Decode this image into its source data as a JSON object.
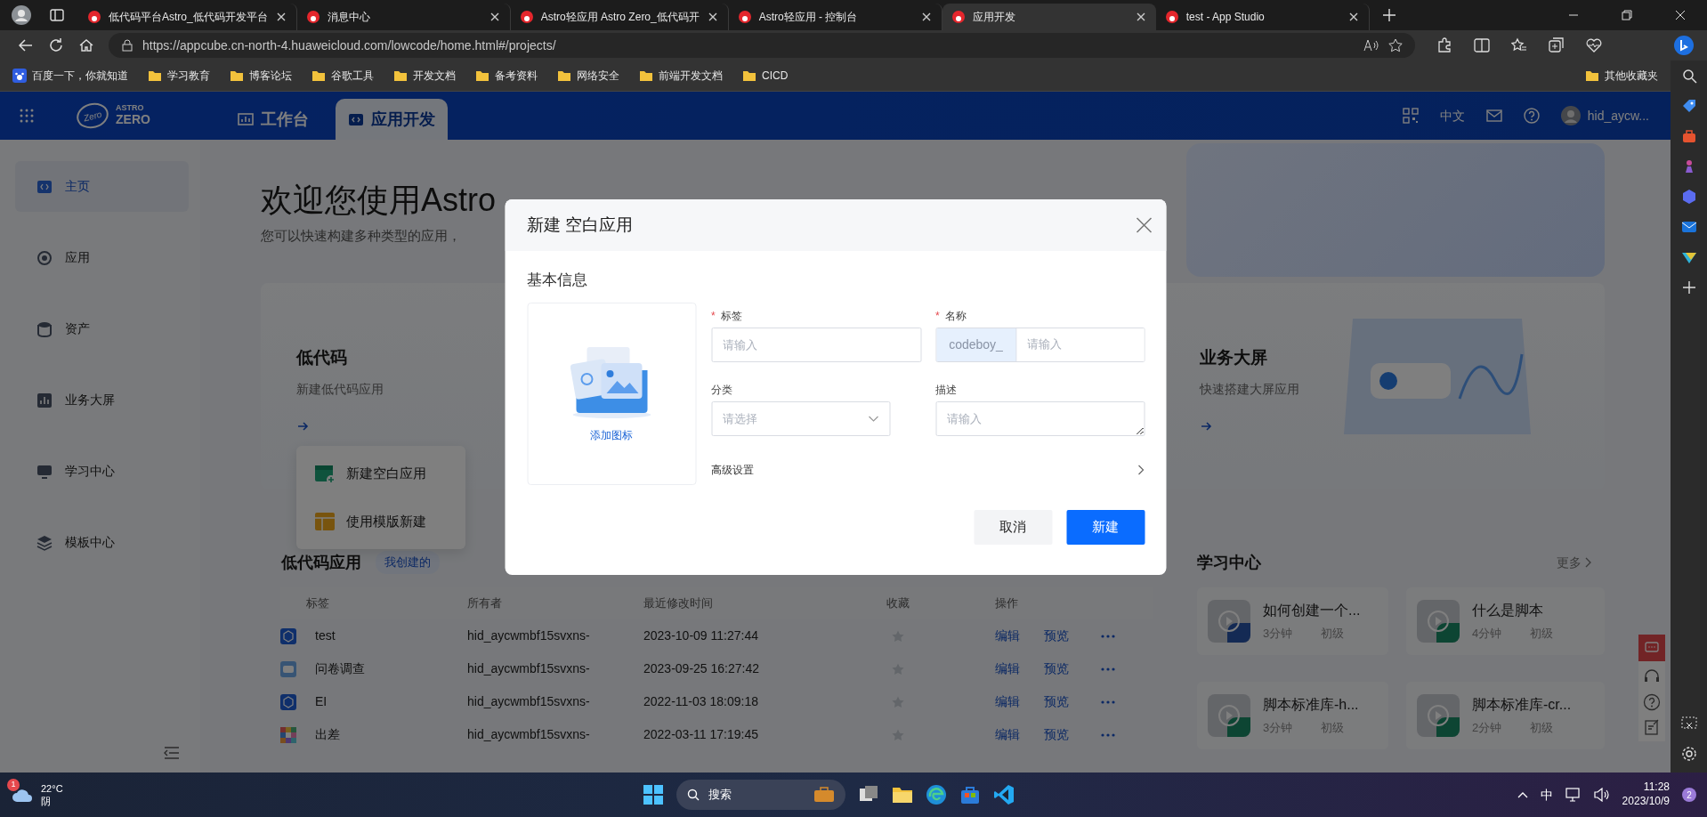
{
  "browser": {
    "tabs": [
      {
        "title": "低代码平台Astro_低代码开发平台",
        "selected": false
      },
      {
        "title": "消息中心",
        "selected": false
      },
      {
        "title": "Astro轻应用 Astro Zero_低代码开",
        "selected": false
      },
      {
        "title": "Astro轻应用 - 控制台",
        "selected": false
      },
      {
        "title": "应用开发",
        "selected": true
      },
      {
        "title": "test - App Studio",
        "selected": false
      }
    ],
    "address": "https://appcube.cn-north-4.huaweicloud.com/lowcode/home.html#/projects/",
    "bookmarks": [
      "百度一下，你就知道",
      "学习教育",
      "博客论坛",
      "谷歌工具",
      "开发文档",
      "备考资料",
      "网络安全",
      "前端开发文档",
      "CICD"
    ],
    "other_bookmarks": "其他收藏夹"
  },
  "app": {
    "logo": {
      "badge": "Zero",
      "top": "ASTRO",
      "bottom": "ZERO"
    },
    "tabs": [
      {
        "label": "工作台",
        "selected": false
      },
      {
        "label": "应用开发",
        "selected": true
      }
    ],
    "language": "中文",
    "user": "hid_aycw..."
  },
  "sidebar": {
    "items": [
      {
        "label": "主页",
        "selected": true
      },
      {
        "label": "应用",
        "selected": false
      },
      {
        "label": "资产",
        "selected": false
      },
      {
        "label": "业务大屏",
        "selected": false
      },
      {
        "label": "学习中心",
        "selected": false
      },
      {
        "label": "模板中心",
        "selected": false
      }
    ]
  },
  "home": {
    "heading": "欢迎您使用Astro",
    "subtitle": "您可以快速构建多种类型的应用，",
    "cards": [
      {
        "title": "低代码",
        "subtitle": "新建低代码应用"
      },
      {
        "title": "业务大屏",
        "subtitle": "快速搭建大屏应用"
      }
    ],
    "create_menu": [
      "新建空白应用",
      "使用模版新建"
    ]
  },
  "low_code_apps": {
    "title": "低代码应用",
    "filter": "我创建的",
    "columns": [
      "标签",
      "所有者",
      "最近修改时间",
      "收藏",
      "操作"
    ],
    "rows": [
      {
        "label": "test",
        "owner": "hid_aycwmbf15svxns-",
        "modified": "2023-10-09 11:27:44",
        "favorite": false,
        "actions": [
          "编辑",
          "预览"
        ]
      },
      {
        "label": "问卷调查",
        "owner": "hid_aycwmbf15svxns-",
        "modified": "2023-09-25 16:27:42",
        "favorite": false,
        "actions": [
          "编辑",
          "预览"
        ]
      },
      {
        "label": "EI",
        "owner": "hid_aycwmbf15svxns-",
        "modified": "2022-11-03 18:09:18",
        "favorite": false,
        "actions": [
          "编辑",
          "预览"
        ]
      },
      {
        "label": "出差",
        "owner": "hid_aycwmbf15svxns-",
        "modified": "2022-03-11 17:19:45",
        "favorite": false,
        "actions": [
          "编辑",
          "预览"
        ]
      }
    ]
  },
  "learning_center": {
    "title": "学习中心",
    "more": "更多",
    "courses": [
      {
        "title": "如何创建一个...",
        "duration": "3分钟",
        "level": "初级"
      },
      {
        "title": "什么是脚本",
        "duration": "4分钟",
        "level": "初级"
      },
      {
        "title": "脚本标准库-h...",
        "duration": "3分钟",
        "level": "初级"
      },
      {
        "title": "脚本标准库-cr...",
        "duration": "2分钟",
        "level": "初级"
      }
    ]
  },
  "dialog": {
    "title": "新建 空白应用",
    "section": "基本信息",
    "upload_label": "添加图标",
    "required_mark": "*",
    "fields": [
      {
        "kind": "text",
        "label": "标签",
        "required": true,
        "placeholder": "请输入"
      },
      {
        "kind": "prefixed",
        "label": "名称",
        "required": true,
        "prefix": "codeboy_",
        "placeholder": "请输入"
      },
      {
        "kind": "select",
        "label": "分类",
        "required": false,
        "placeholder": "请选择"
      },
      {
        "kind": "textarea",
        "label": "描述",
        "required": false,
        "placeholder": "请输入"
      }
    ],
    "advanced": "高级设置",
    "buttons": [
      {
        "label": "取消",
        "kind": "secondary"
      },
      {
        "label": "新建",
        "kind": "primary"
      }
    ]
  },
  "taskbar": {
    "weather": {
      "temp": "22°C",
      "condition": "阴",
      "badge": "1"
    },
    "search": "搜索",
    "ime": "中",
    "time": "11:28",
    "date": "2023/10/9",
    "notifications": "2"
  }
}
